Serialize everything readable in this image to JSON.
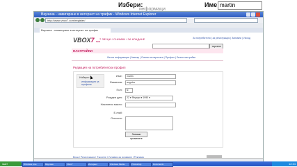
{
  "topbar": {
    "izberi_label": "Избери:",
    "faint_text": "информаци",
    "ime_label": "Име",
    "name_value": "martin"
  },
  "window": {
    "title": "Ваучина - навигиране в интернет на трафик - Windows Internet Explorer",
    "url": "http://www.vbox7.com/register/",
    "tab_label": "Ваучина - навигиране в интернет на трафик"
  },
  "site": {
    "logo_main": "VBOX",
    "logo_seven": "7",
    "logo_sub": "beta",
    "top_links": "7 ЗВУЦИ / СНИМКИ / ЗА КЛАДАНЕ",
    "user_links": "За потребители | за регистрация | Запомни | Изход",
    "search_button": "търсене",
    "nav_heading": "НАСТРОЙКИ",
    "sub_nav": "Лична информация | Аватар | Смяна на паролата | Профил | Лични настройки",
    "page_title": "Редакция на потребителски профил"
  },
  "form": {
    "side_title": "Избери:",
    "side_link": "информация за профила",
    "fields": {
      "name_label": "Име:",
      "name_value": "martin",
      "family_label": "Фамилия:",
      "family_value": "angelov",
      "sex_label": "Пол:",
      "sex_value": "м",
      "birth_label": "Рожден ден:",
      "birth_value": "22 ▾ Януари ▾ 1990 ▾",
      "city_label": "Населено място:",
      "email_label": "E-mail:",
      "about_label": "Относно:"
    },
    "submit_label": "Запиши промените"
  },
  "footer": {
    "links": "Вход | Регистрация | Търсене | Условия за ползване | Реклама",
    "status": ""
  },
  "taskbar": {
    "start_label": "start",
    "tasks": [
      "Windows Live",
      "Ваучина",
      "Vbox7",
      "Интернет",
      "Windows Media",
      "Photoshop",
      "Documents"
    ],
    "clock": "12:34"
  }
}
